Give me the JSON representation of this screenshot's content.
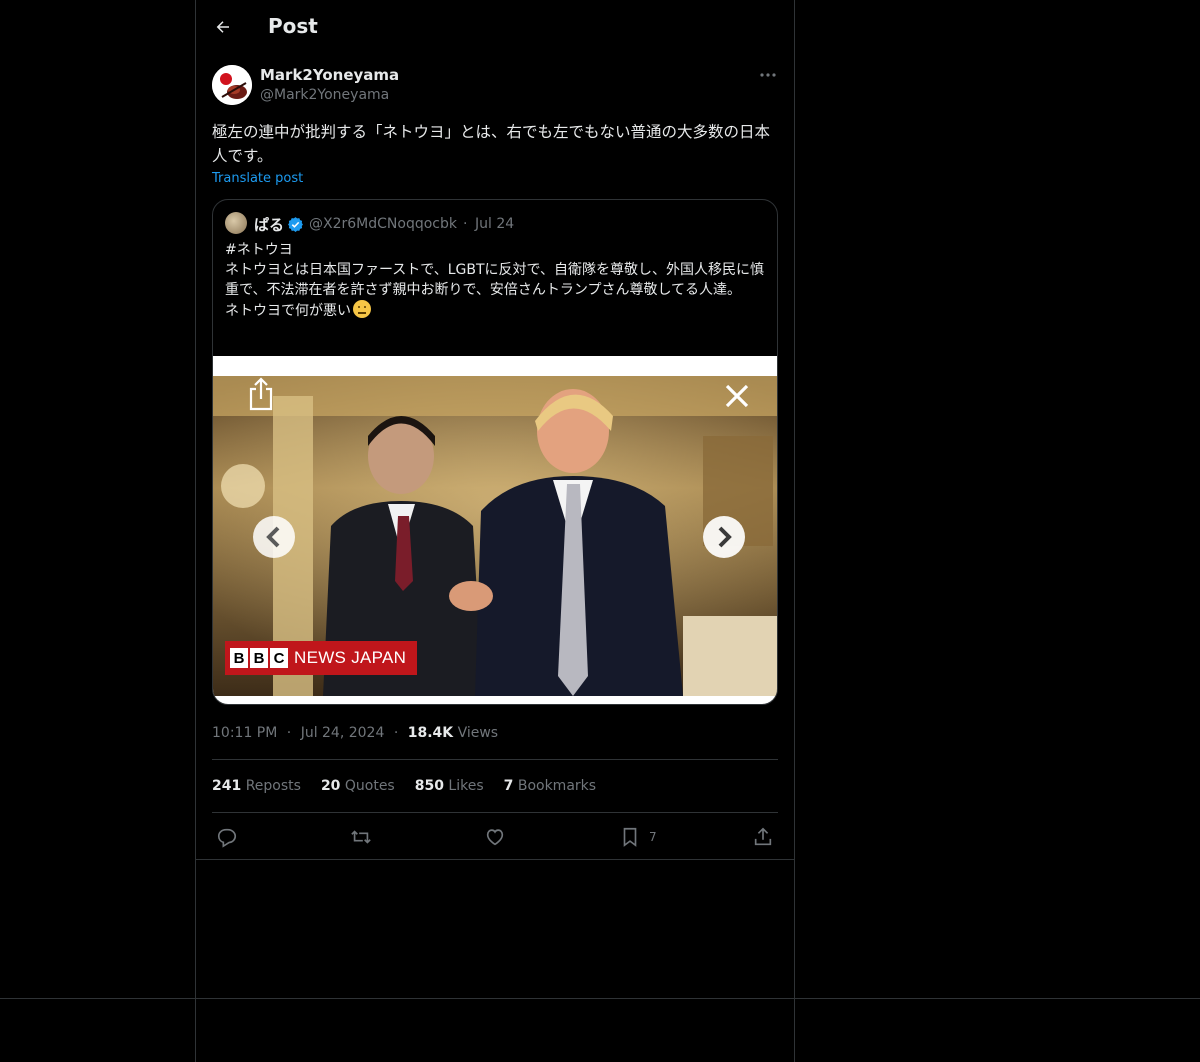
{
  "header": {
    "title": "Post",
    "back_icon": "arrow-left-icon"
  },
  "author": {
    "display_name": "Mark2Yoneyama",
    "handle": "@Mark2Yoneyama",
    "more_icon": "more-icon"
  },
  "post": {
    "text": "極左の連中が批判する「ネトウヨ」とは、右でも左でもない普通の大多数の日本人です。",
    "translate_label": "Translate post"
  },
  "quote": {
    "display_name": "ぱる",
    "verified_color": "#1d9bf0",
    "handle": "@X2r6MdCNoqqocbk",
    "separator": "·",
    "date": "Jul 24",
    "lines": [
      "#ネトウヨ",
      "ネトウヨとは日本国ファーストで、LGBTに反対で、自衛隊を尊敬し、外国人移民に慎重で、不法滞在者を許さず親中お断りで、安倍さんトランプさん尊敬してる人達。",
      "ネトウヨで何が悪い"
    ],
    "image": {
      "watermark_bbc": [
        "B",
        "B",
        "C"
      ],
      "watermark_text": "NEWS JAPAN"
    }
  },
  "meta": {
    "time": "10:11 PM",
    "separator": "·",
    "date": "Jul 24, 2024",
    "views_count": "18.4K",
    "views_label": "Views"
  },
  "stats": {
    "reposts_count": "241",
    "reposts_label": "Reposts",
    "quotes_count": "20",
    "quotes_label": "Quotes",
    "likes_count": "850",
    "likes_label": "Likes",
    "bookmarks_count": "7",
    "bookmarks_label": "Bookmarks"
  },
  "actions": {
    "reply_icon": "reply-icon",
    "repost_icon": "repost-icon",
    "like_icon": "heart-icon",
    "bookmark_icon": "bookmark-icon",
    "bookmark_count": "7",
    "share_icon": "share-icon"
  },
  "colors": {
    "background": "#000000",
    "border": "#2f3336",
    "text": "#e7e9ea",
    "secondary": "#71767b",
    "accent": "#1d9bf0"
  }
}
